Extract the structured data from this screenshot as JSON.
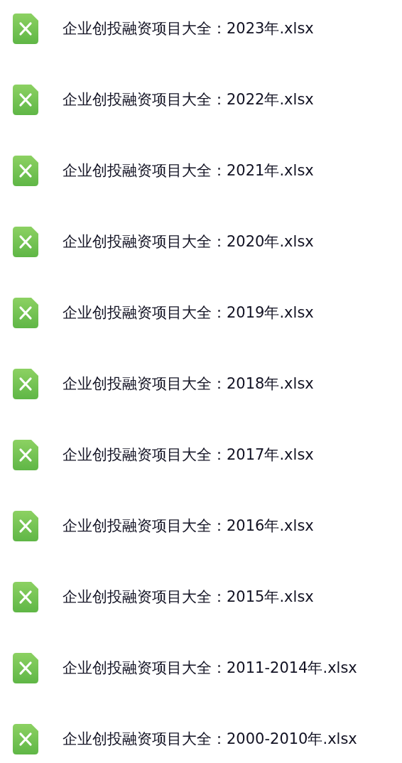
{
  "files": [
    {
      "name": "企业创投融资项目大全：2023年.xlsx"
    },
    {
      "name": "企业创投融资项目大全：2022年.xlsx"
    },
    {
      "name": "企业创投融资项目大全：2021年.xlsx"
    },
    {
      "name": "企业创投融资项目大全：2020年.xlsx"
    },
    {
      "name": "企业创投融资项目大全：2019年.xlsx"
    },
    {
      "name": "企业创投融资项目大全：2018年.xlsx"
    },
    {
      "name": "企业创投融资项目大全：2017年.xlsx"
    },
    {
      "name": "企业创投融资项目大全：2016年.xlsx"
    },
    {
      "name": "企业创投融资项目大全：2015年.xlsx"
    },
    {
      "name": "企业创投融资项目大全：2011-2014年.xlsx"
    },
    {
      "name": "企业创投融资项目大全：2000-2010年.xlsx"
    }
  ]
}
